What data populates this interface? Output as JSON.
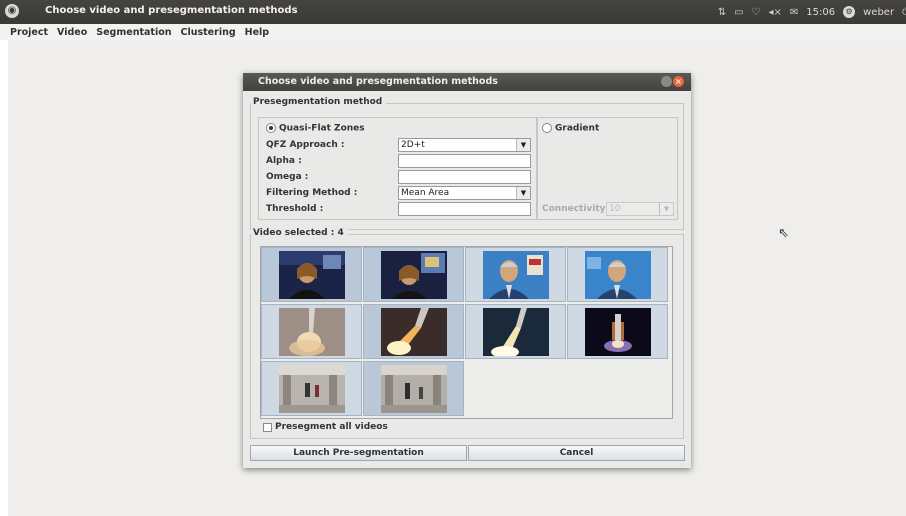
{
  "topbar": {
    "window_title": "Choose video and presegmentation methods",
    "time": "15:06",
    "user": "weber"
  },
  "menubar": {
    "items": [
      "Project",
      "Video",
      "Segmentation",
      "Clustering",
      "Help"
    ]
  },
  "dialog": {
    "title": "Choose video and presegmentation methods",
    "preseg_group_label": "Presegmentation method",
    "qfz_radio_label": "Quasi-Flat Zones",
    "gradient_radio_label": "Gradient",
    "qfz_selected": true,
    "qfz_approach_label": "QFZ Approach :",
    "qfz_approach_value": "2D+t",
    "alpha_label": "Alpha :",
    "alpha_value": "",
    "omega_label": "Omega :",
    "omega_value": "",
    "filtering_label": "Filtering Method :",
    "filtering_value": "Mean Area",
    "threshold_label": "Threshold :",
    "threshold_value": "",
    "connectivity_label": "Connectivity :",
    "connectivity_value": "10",
    "video_group_label": "Video selected : 4",
    "presegment_all_label": "Presegment all videos",
    "presegment_all_checked": false,
    "launch_button": "Launch Pre-segmentation",
    "cancel_button": "Cancel",
    "thumbnails": [
      {
        "name": "news-anchor-woman-1",
        "selected": true
      },
      {
        "name": "news-anchor-woman-2",
        "selected": true
      },
      {
        "name": "news-anchor-man-1",
        "selected": false
      },
      {
        "name": "news-anchor-man-2",
        "selected": false
      },
      {
        "name": "rocket-launch-1",
        "selected": false
      },
      {
        "name": "rocket-launch-2",
        "selected": true
      },
      {
        "name": "rocket-launch-3",
        "selected": false
      },
      {
        "name": "rocket-launch-4",
        "selected": false
      },
      {
        "name": "station-hall-1",
        "selected": false
      },
      {
        "name": "station-hall-2",
        "selected": true
      }
    ]
  },
  "colors": {
    "topbar_bg": "#3c3b37",
    "dialog_title_bg": "#4a4945",
    "close_button": "#e9653a",
    "selected_cell": "#b8c8d8"
  }
}
